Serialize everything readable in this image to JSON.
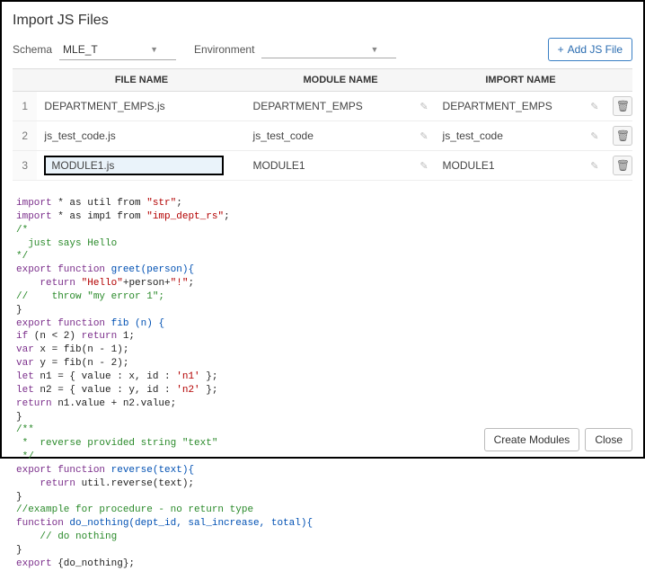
{
  "dialog": {
    "title": "Import JS Files",
    "schema_label": "Schema",
    "schema_value": "MLE_T",
    "environment_label": "Environment",
    "environment_value": "",
    "add_button": "Add JS File",
    "create_modules": "Create Modules",
    "close": "Close"
  },
  "table": {
    "headers": {
      "file_name": "FILE NAME",
      "module_name": "MODULE NAME",
      "import_name": "IMPORT NAME"
    },
    "rows": [
      {
        "num": "1",
        "file": "DEPARTMENT_EMPS.js",
        "module": "DEPARTMENT_EMPS",
        "import": "DEPARTMENT_EMPS"
      },
      {
        "num": "2",
        "file": "js_test_code.js",
        "module": "js_test_code",
        "import": "js_test_code"
      },
      {
        "num": "3",
        "file": "MODULE1.js",
        "module": "MODULE1",
        "import": "MODULE1"
      }
    ]
  },
  "code": {
    "l1a": "import",
    "l1b": " * as util from ",
    "l1c": "\"str\"",
    "l1d": ";",
    "l2a": "import",
    "l2b": " * as imp1 from ",
    "l2c": "\"imp_dept_rs\"",
    "l2d": ";",
    "l3": "/*",
    "l4": "  just says Hello",
    "l5": "*/",
    "l6a": "export function",
    "l6b": " greet(person){",
    "l7a": "    return ",
    "l7b": "\"Hello\"",
    "l7c": "+person+",
    "l7d": "\"!\"",
    "l7e": ";",
    "l8a": "//    throw \"my error 1\";",
    "l9": "}",
    "l10a": "export function",
    "l10b": " fib (n) {",
    "l11a": "if",
    "l11b": " (n < 2) ",
    "l11c": "return",
    "l11d": " 1;",
    "l12a": "var",
    "l12b": " x = fib(n - 1);",
    "l13a": "var",
    "l13b": " y = fib(n - 2);",
    "l14a": "let",
    "l14b": " n1 = { value : x, id : ",
    "l14c": "'n1'",
    "l14d": " };",
    "l15a": "let",
    "l15b": " n2 = { value : y, id : ",
    "l15c": "'n2'",
    "l15d": " };",
    "l16a": "return",
    "l16b": " n1.value + n2.value;",
    "l17": "}",
    "l18": "/**",
    "l19": " *  reverse provided string \"text\"",
    "l20": " */",
    "l21a": "export function",
    "l21b": " reverse(text){",
    "l22a": "    return",
    "l22b": " util.reverse(text);",
    "l23": "}",
    "l24": "//example for procedure - no return type",
    "l25a": "function",
    "l25b": " do_nothing(dept_id, sal_increase, total){",
    "l26": "    // do nothing",
    "l27": "}",
    "l28a": "export",
    "l28b": " {do_nothing};"
  }
}
